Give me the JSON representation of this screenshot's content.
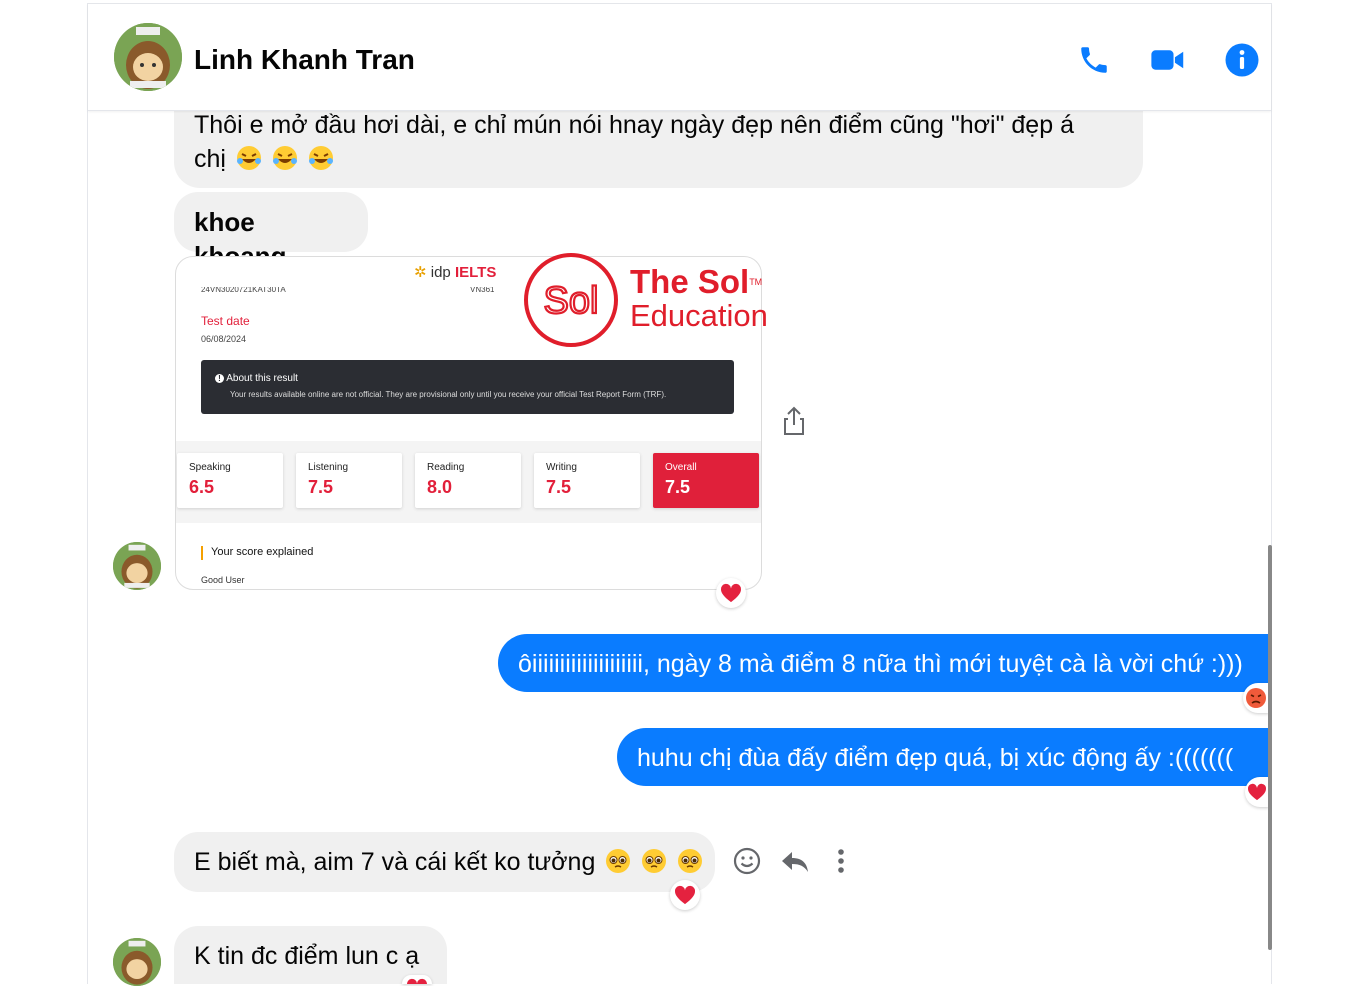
{
  "contact": {
    "name": "Linh Khanh Tran"
  },
  "header_icons": [
    "phone-icon",
    "video-icon",
    "info-icon"
  ],
  "messages": {
    "m1_line1": "Thôi e mở đầu hơi dài, e chỉ mún nói hnay ngày đẹp nên điểm cũng \"hơi\" đẹp á",
    "m1_line2": "chị",
    "m2": "khoe khoang",
    "m3": "ôiiiiiiiiiiiiiiiiiiii, ngày 8 mà điểm 8 nữa thì mới tuyệt cà là vời chứ :)))",
    "m4": "huhu chị đùa đấy điểm đẹp quá, bị xúc động ấy :(((((((",
    "m5": "E biết mà, aim 7 và cái kết ko tưởng",
    "m6": "K tin đc điểm lun c ạ"
  },
  "ielts_card": {
    "brand": "idp",
    "brand_product": "IELTS",
    "ref_left": "24VN3020721KAT30TA",
    "ref_right": "VN361",
    "test_date_label": "Test date",
    "test_date": "06/08/2024",
    "notice_title": "About this result",
    "notice_text": "Your results available online are not official. They are provisional only until you receive your official Test Report Form (TRF).",
    "scores": [
      {
        "label": "Speaking",
        "value": "6.5"
      },
      {
        "label": "Listening",
        "value": "7.5"
      },
      {
        "label": "Reading",
        "value": "8.0"
      },
      {
        "label": "Writing",
        "value": "7.5"
      },
      {
        "label": "Overall",
        "value": "7.5"
      }
    ],
    "explained_label": "Your score explained",
    "level": "Good User"
  },
  "watermark": {
    "line1": "The Sol",
    "tm": "TM",
    "line2": "Education",
    "logo": "Sol"
  },
  "colors": {
    "accent": "#0a7cff",
    "ielts_red": "#e21f3a",
    "watermark_red": "#e01e2b"
  }
}
